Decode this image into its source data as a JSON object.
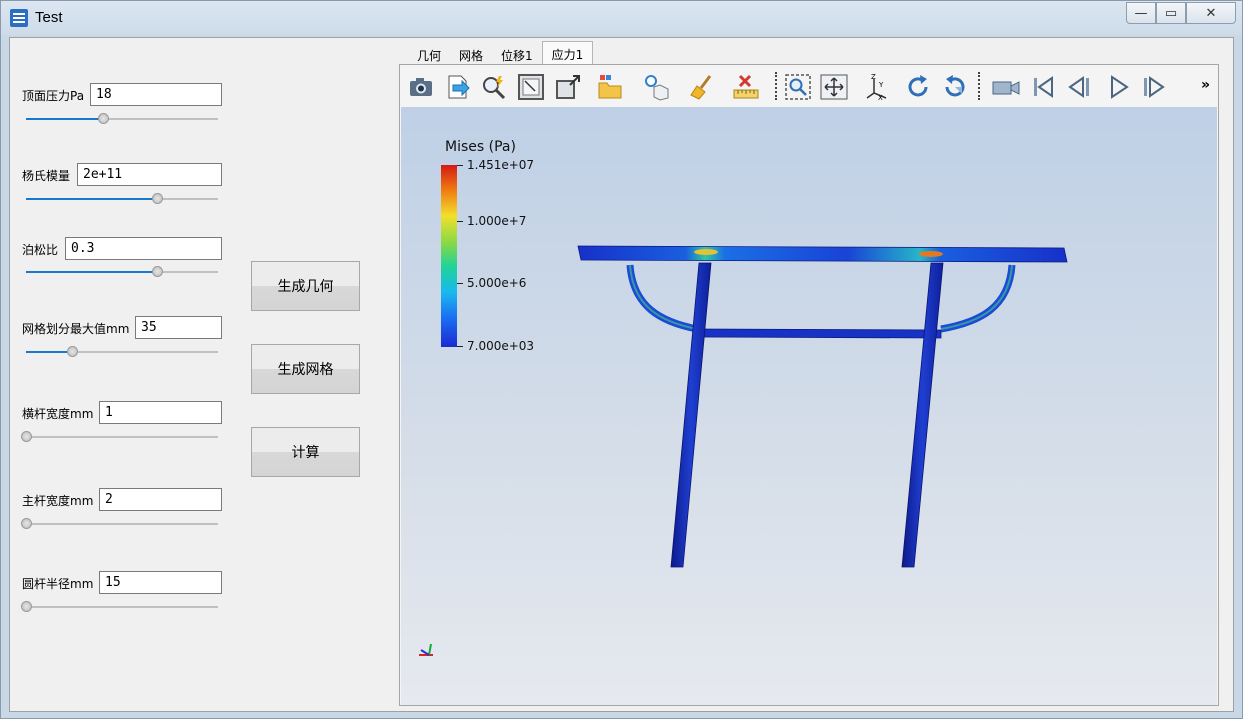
{
  "window": {
    "title": "Test",
    "min_glyph": "—",
    "max_glyph": "▭",
    "close_glyph": "✕"
  },
  "params": [
    {
      "label": "顶面压力Pa",
      "value": "18",
      "slider": 0.4
    },
    {
      "label": "杨氏模量",
      "value": "2e+11",
      "slider": 0.68
    },
    {
      "label": "泊松比",
      "value": "0.3",
      "slider": 0.68
    },
    {
      "label": "网格划分最大值mm",
      "value": "35",
      "slider": 0.24
    },
    {
      "label": "横杆宽度mm",
      "value": "1",
      "slider": 0.0
    },
    {
      "label": "主杆宽度mm",
      "value": "2",
      "slider": 0.0
    },
    {
      "label": "圆杆半径mm",
      "value": "15",
      "slider": 0.0
    }
  ],
  "buttons": {
    "gen_geometry": "生成几何",
    "gen_mesh": "生成网格",
    "compute": "计算"
  },
  "tabs": [
    {
      "label": "几何",
      "active": false
    },
    {
      "label": "网格",
      "active": false
    },
    {
      "label": "位移1",
      "active": false
    },
    {
      "label": "应力1",
      "active": true
    }
  ],
  "toolbar": {
    "icons": [
      "camera-icon",
      "export-icon",
      "probe-icon",
      "zoom-box-icon",
      "scale-icon",
      "folder-icon",
      "light-icon",
      "broom-icon",
      "ruler-icon",
      "zoom-fit-icon",
      "pan-icon",
      "axes-icon",
      "rotate-cw-icon",
      "rotate-ccw-icon",
      "video-icon",
      "first-frame-icon",
      "prev-frame-icon",
      "play-icon",
      "next-frame-icon"
    ],
    "overflow": "»"
  },
  "legend": {
    "title": "Mises (Pa)",
    "max": "1.451e+07",
    "t1": "1.000e+7",
    "t2": "5.000e+6",
    "min": "7.000e+03",
    "max_value": 14510000,
    "min_value": 7000
  }
}
